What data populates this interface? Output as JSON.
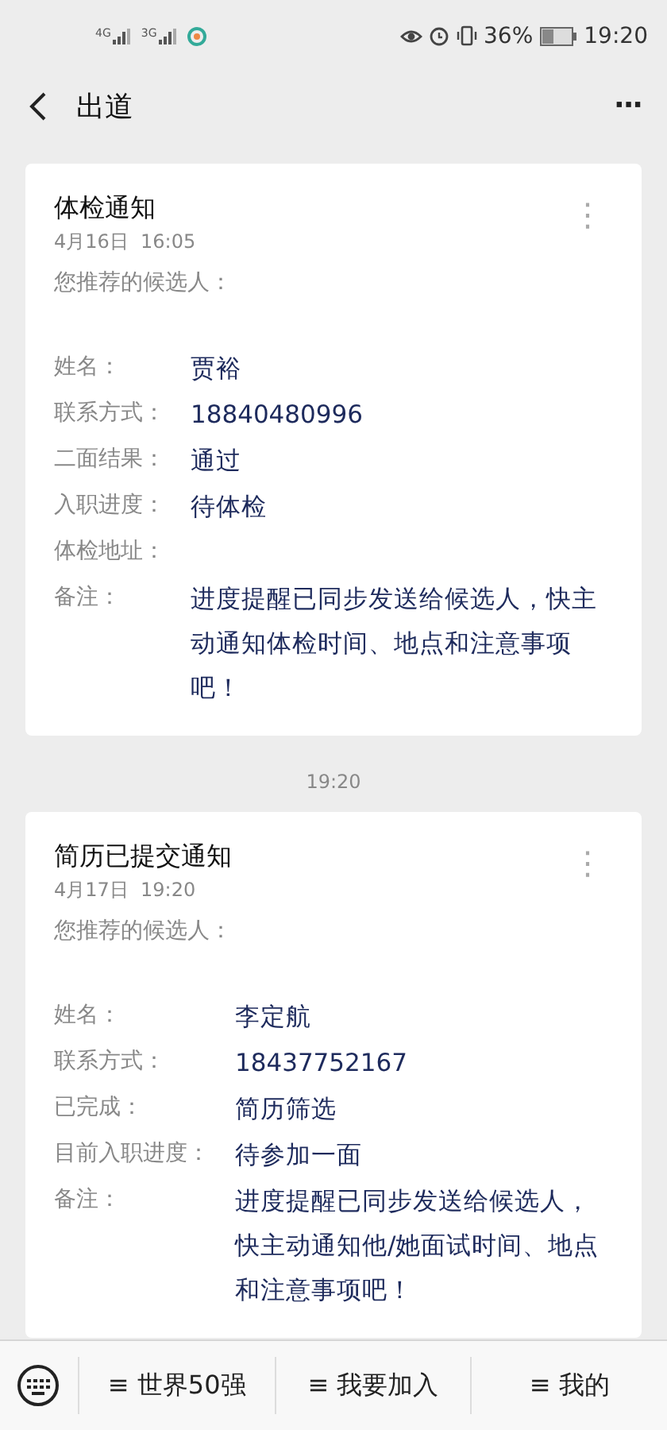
{
  "status_bar": {
    "signals": [
      "4G",
      "3G"
    ],
    "battery_percent": "36%",
    "time": "19:20"
  },
  "nav": {
    "title": "出道",
    "more": "···"
  },
  "messages": [
    {
      "title": "体检通知",
      "date": "4月16日  16:05",
      "intro": "您推荐的候选人：",
      "more": "⋮",
      "fields": [
        {
          "label": "姓名：",
          "value": "贾裕"
        },
        {
          "label": "联系方式：",
          "value": "18840480996"
        },
        {
          "label": "二面结果：",
          "value": "通过"
        },
        {
          "label": "入职进度：",
          "value": "待体检"
        },
        {
          "label": "体检地址："
        },
        {
          "label": "备注：",
          "value": "进度提醒已同步发送给候选人，快主动通知体检时间、地点和注意事项吧！"
        }
      ]
    },
    {
      "timestamp": "19:20",
      "title": "简历已提交通知",
      "date": "4月17日  19:20",
      "intro": "您推荐的候选人：",
      "more": "⋮",
      "fields": [
        {
          "label": "姓名：",
          "value": "李定航"
        },
        {
          "label": "联系方式：",
          "value": "18437752167"
        },
        {
          "label": "已完成：",
          "value": "简历筛选"
        },
        {
          "label": "目前入职进度：",
          "value": "待参加一面"
        },
        {
          "label": "备注：",
          "value": "进度提醒已同步发送给候选人，快主动通知他/她面试时间、地点和注意事项吧！"
        }
      ]
    }
  ],
  "bottom_menu": [
    {
      "label": "≡ 世界50强"
    },
    {
      "label": "≡ 我要加入"
    },
    {
      "label": "≡ 我的"
    }
  ]
}
